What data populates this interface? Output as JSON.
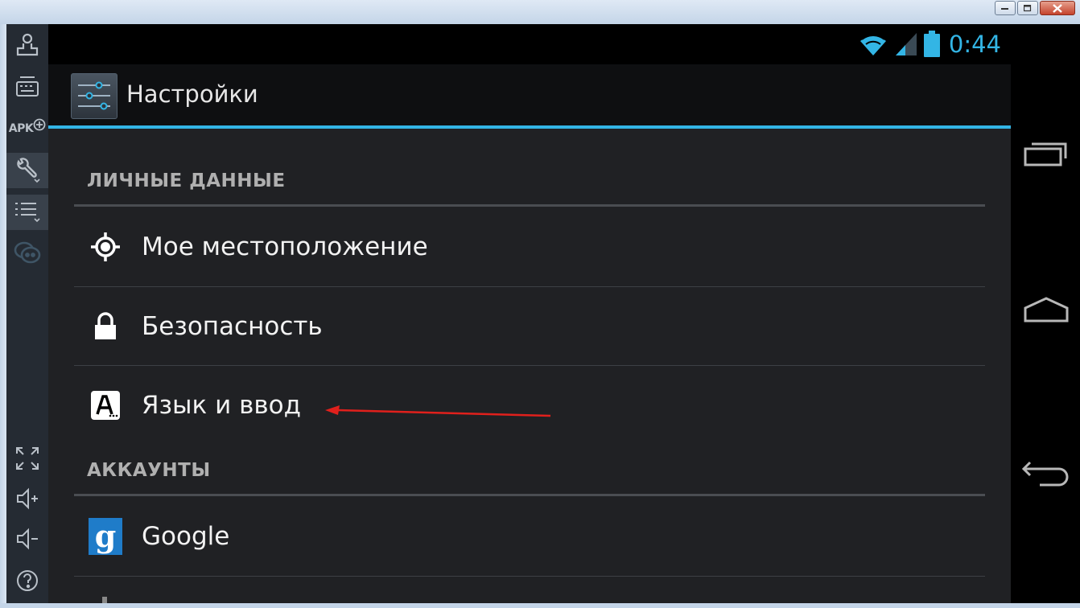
{
  "window": {
    "controls": [
      "minimize",
      "maximize",
      "close"
    ]
  },
  "toolbar": {
    "apk_label": "APK",
    "icons": [
      "device-icon",
      "keyboard-icon",
      "apk-install-icon",
      "wrench-icon",
      "list-icon",
      "chat-icon",
      "fullscreen-icon",
      "volume-up-icon",
      "volume-down-icon",
      "help-icon"
    ]
  },
  "status_bar": {
    "time": "0:44",
    "accent_color": "#33b5e5"
  },
  "action_bar": {
    "title": "Настройки"
  },
  "sections": {
    "personal": {
      "header": "ЛИЧНЫЕ ДАННЫЕ",
      "items": [
        {
          "label": "Мое местоположение",
          "icon": "location-icon"
        },
        {
          "label": "Безопасность",
          "icon": "lock-icon"
        },
        {
          "label": "Язык и ввод",
          "icon": "language-input-icon"
        }
      ]
    },
    "accounts": {
      "header": "АККАУНТЫ",
      "items": [
        {
          "label": "Google",
          "icon": "google-icon",
          "icon_glyph": "g",
          "icon_color": "#1f7cc9"
        }
      ]
    }
  },
  "annotation": {
    "color": "#e0201c"
  },
  "nav": [
    "recent-apps-icon",
    "home-icon",
    "back-icon"
  ]
}
